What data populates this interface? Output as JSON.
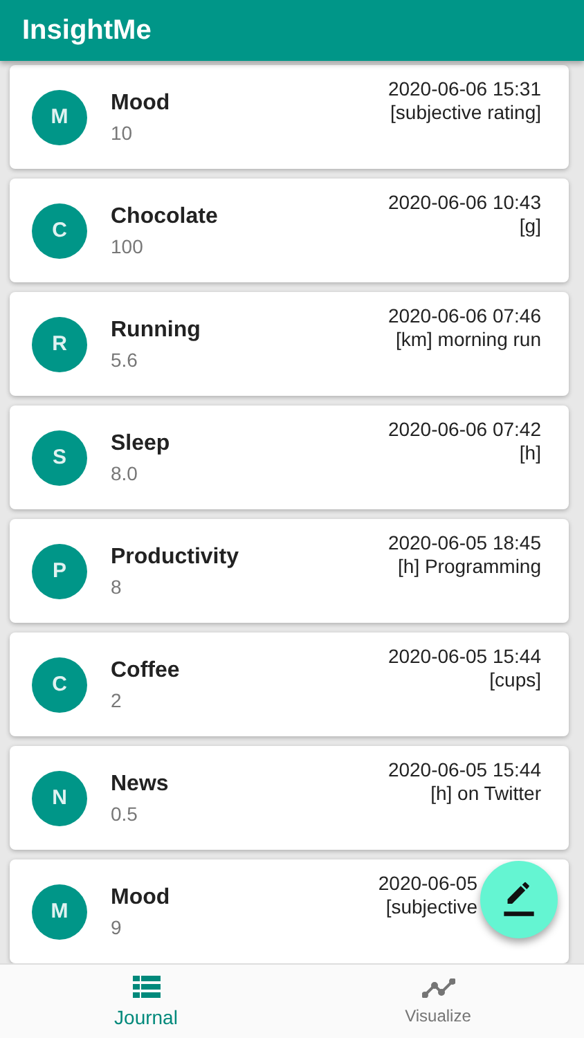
{
  "app_bar": {
    "title": "InsightMe"
  },
  "entries": [
    {
      "initial": "M",
      "name": "Mood",
      "value": "10",
      "time": "2020-06-06 15:31",
      "note": "[subjective rating]"
    },
    {
      "initial": "C",
      "name": "Chocolate",
      "value": "100",
      "time": "2020-06-06 10:43",
      "note": "[g]"
    },
    {
      "initial": "R",
      "name": "Running",
      "value": "5.6",
      "time": "2020-06-06 07:46",
      "note": "[km] morning run"
    },
    {
      "initial": "S",
      "name": "Sleep",
      "value": "8.0",
      "time": "2020-06-06 07:42",
      "note": "[h]"
    },
    {
      "initial": "P",
      "name": "Productivity",
      "value": "8",
      "time": "2020-06-05 18:45",
      "note": "[h] Programming"
    },
    {
      "initial": "C",
      "name": "Coffee",
      "value": "2",
      "time": "2020-06-05 15:44",
      "note": "[cups]"
    },
    {
      "initial": "N",
      "name": "News",
      "value": "0.5",
      "time": "2020-06-05 15:44",
      "note": "[h] on Twitter"
    },
    {
      "initial": "M",
      "name": "Mood",
      "value": "9",
      "time": "2020-06-05",
      "note": "[subjective"
    }
  ],
  "bottom_nav": [
    {
      "label": "Journal",
      "selected": true
    },
    {
      "label": "Visualize",
      "selected": false
    }
  ]
}
